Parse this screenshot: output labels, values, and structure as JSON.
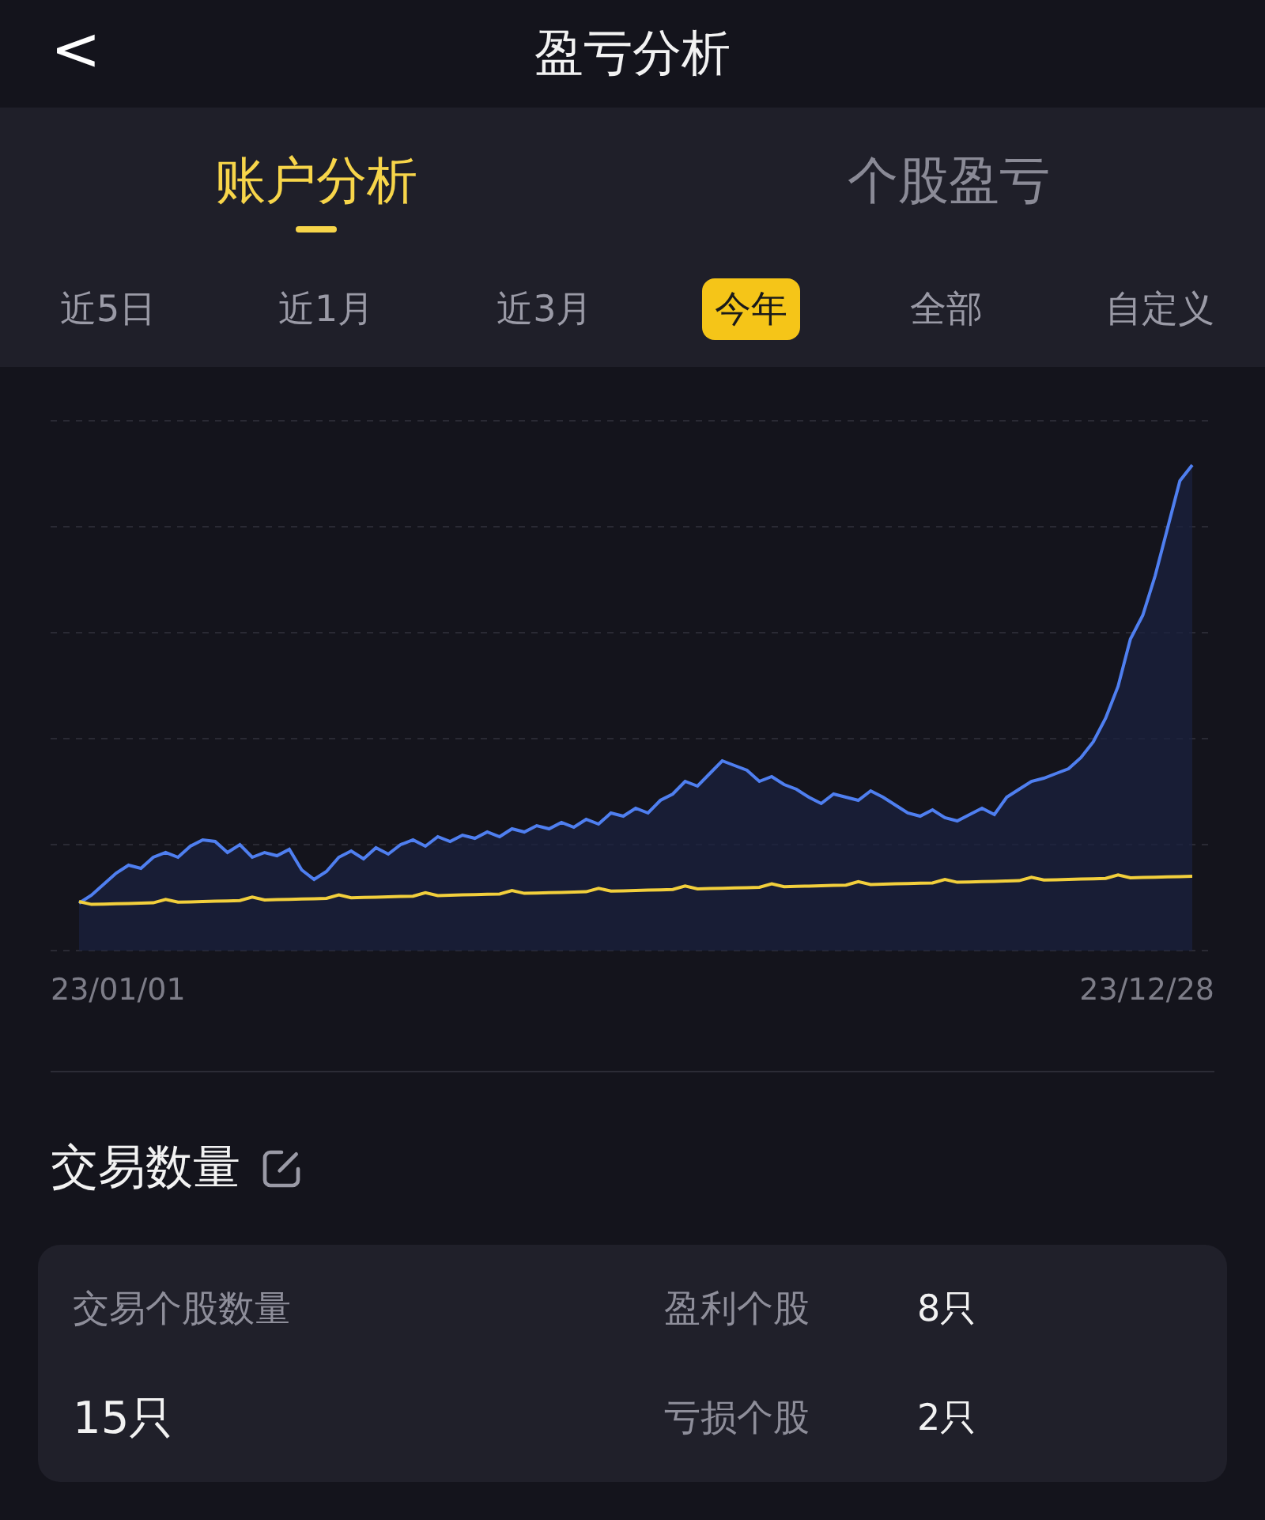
{
  "header": {
    "back": "<",
    "title": "盈亏分析"
  },
  "main_tabs": [
    {
      "label": "账户分析",
      "selected": true
    },
    {
      "label": "个股盈亏",
      "selected": false
    }
  ],
  "periods": [
    {
      "label": "近5日",
      "selected": false
    },
    {
      "label": "近1月",
      "selected": false
    },
    {
      "label": "近3月",
      "selected": false
    },
    {
      "label": "今年",
      "selected": true
    },
    {
      "label": "全部",
      "selected": false
    },
    {
      "label": "自定义",
      "selected": false
    }
  ],
  "chart": {
    "x_start": "23/01/01",
    "x_end": "23/12/28"
  },
  "section": {
    "title": "交易数量"
  },
  "stats": {
    "total_label": "交易个股数量",
    "total_value": "15只",
    "rows": [
      {
        "label": "盈利个股",
        "value": "8只"
      },
      {
        "label": "亏损个股",
        "value": "2只"
      }
    ]
  }
}
